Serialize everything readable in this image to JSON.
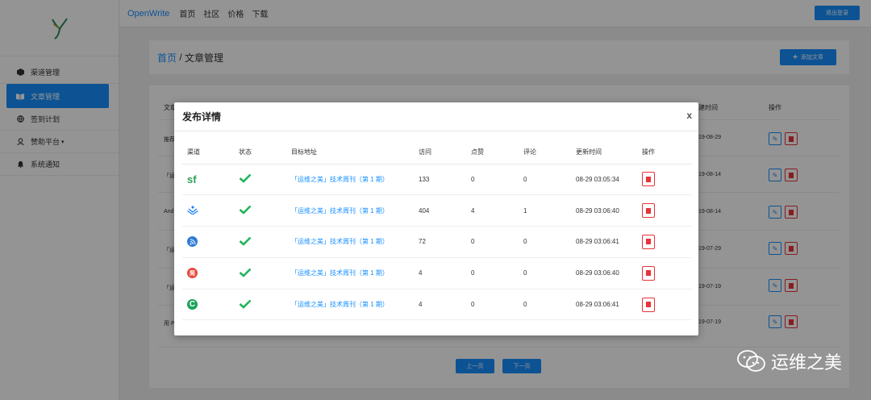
{
  "topbar": {
    "brand": "OpenWrite",
    "nav": [
      "首页",
      "社区",
      "价格",
      "下载"
    ],
    "logout_label": "退出登录"
  },
  "sidebar": {
    "items": [
      {
        "label": "渠道管理",
        "icon": "cube-icon"
      },
      {
        "label": "文章管理",
        "icon": "book-icon",
        "active": true
      },
      {
        "label": "签到计划",
        "icon": "globe-icon"
      },
      {
        "label": "赞助平台",
        "icon": "user-icon"
      },
      {
        "label": "系统通知",
        "icon": "bell-icon"
      }
    ]
  },
  "page": {
    "breadcrumb_home": "首页",
    "breadcrumb_sep": " / ",
    "breadcrumb_current": "文章管理",
    "add_label": "添加文章"
  },
  "background_table": {
    "col_article": "文章",
    "col_created": "建时间",
    "col_action": "操作",
    "row_labels": [
      "推荐",
      "「运",
      "Andr",
      "「运",
      "「运",
      "用 P"
    ],
    "dates": [
      "19-08-29",
      "19-08-14",
      "19-08-14",
      "19-07-29",
      "19-07-19",
      "19-07-19"
    ]
  },
  "pager": {
    "prev": "上一页",
    "next": "下一页"
  },
  "modal": {
    "title": "发布详情",
    "close": "x",
    "headers": [
      "渠道",
      "状态",
      "目标地址",
      "访问",
      "点赞",
      "评论",
      "更新时间",
      "操作"
    ],
    "rows": [
      {
        "channel_text": "sf",
        "link": "「运维之美」技术周刊（第 1 期）",
        "views": "133",
        "likes": "0",
        "comments": "0",
        "updated": "08-29 03:05:34"
      },
      {
        "channel_text": "",
        "link": "「运维之美」技术周刊（第 1 期）",
        "views": "404",
        "likes": "4",
        "comments": "1",
        "updated": "08-29 03:06:40"
      },
      {
        "channel_text": "",
        "link": "「运维之美」技术周刊（第 1 期）",
        "views": "72",
        "likes": "0",
        "comments": "0",
        "updated": "08-29 03:06:41"
      },
      {
        "channel_text": "简",
        "link": "「运维之美」技术周刊（第 1 期）",
        "views": "4",
        "likes": "0",
        "comments": "0",
        "updated": "08-29 03:06:40"
      },
      {
        "channel_text": "C",
        "link": "「运维之美」技术周刊（第 1 期）",
        "views": "4",
        "likes": "0",
        "comments": "0",
        "updated": "08-29 03:06:41"
      }
    ]
  },
  "watermark": "运维之美",
  "colors": {
    "accent": "#1890ff",
    "danger": "#e8323a",
    "success": "#20b45a"
  }
}
